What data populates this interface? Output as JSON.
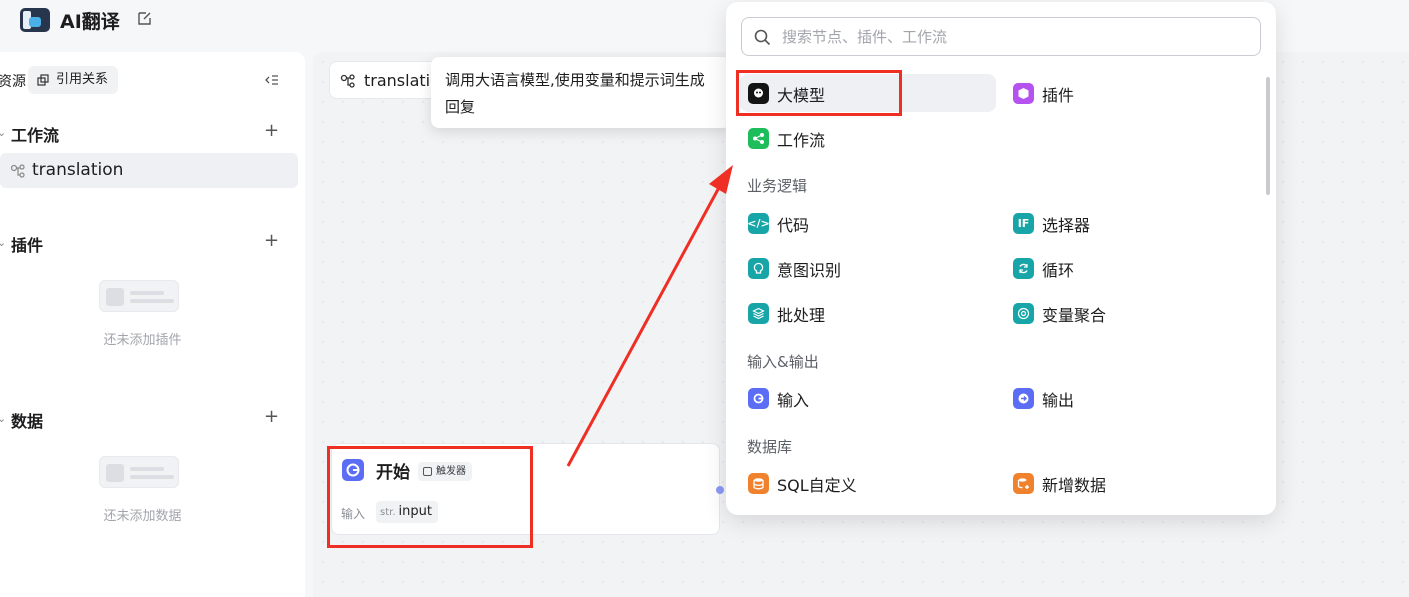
{
  "header": {
    "app_title": "AI翻译"
  },
  "sidebar": {
    "resource_label": "资源",
    "ref_button": "引用关系",
    "sections": {
      "workflow": {
        "title": "工作流",
        "items": [
          "translation"
        ]
      },
      "plugins": {
        "title": "插件",
        "empty_text": "还未添加插件"
      },
      "data": {
        "title": "数据",
        "empty_text": "还未添加数据"
      }
    }
  },
  "canvas": {
    "tab_label": "translati",
    "tooltip": "调用大语言模型,使用变量和提示词生成回复",
    "start_node": {
      "title": "开始",
      "badge": "触发器",
      "input_label": "输入",
      "input_type": "str.",
      "input_name": "input"
    }
  },
  "node_panel": {
    "search_placeholder": "搜索节点、插件、工作流",
    "top_items": [
      {
        "label": "大模型",
        "icon": "llm-icon",
        "color": "#141414"
      },
      {
        "label": "插件",
        "icon": "plugin-icon",
        "color": "#b652ef"
      },
      {
        "label": "工作流",
        "icon": "workflow-icon",
        "color": "#1dbd5c"
      }
    ],
    "categories": [
      {
        "title": "业务逻辑",
        "items": [
          {
            "label": "代码",
            "icon": "code-icon",
            "color": "#17a5a8"
          },
          {
            "label": "选择器",
            "icon": "if-icon",
            "color": "#17a5a8"
          },
          {
            "label": "意图识别",
            "icon": "intent-icon",
            "color": "#17a5a8"
          },
          {
            "label": "循环",
            "icon": "loop-icon",
            "color": "#17a5a8"
          },
          {
            "label": "批处理",
            "icon": "batch-icon",
            "color": "#17a5a8"
          },
          {
            "label": "变量聚合",
            "icon": "aggregate-icon",
            "color": "#17a5a8"
          }
        ]
      },
      {
        "title": "输入&输出",
        "items": [
          {
            "label": "输入",
            "icon": "input-icon",
            "color": "#5b6cf5"
          },
          {
            "label": "输出",
            "icon": "output-icon",
            "color": "#5b6cf5"
          }
        ]
      },
      {
        "title": "数据库",
        "items": [
          {
            "label": "SQL自定义",
            "icon": "sql-icon",
            "color": "#f0822e"
          },
          {
            "label": "新增数据",
            "icon": "add-data-icon",
            "color": "#f0822e"
          }
        ]
      }
    ]
  }
}
